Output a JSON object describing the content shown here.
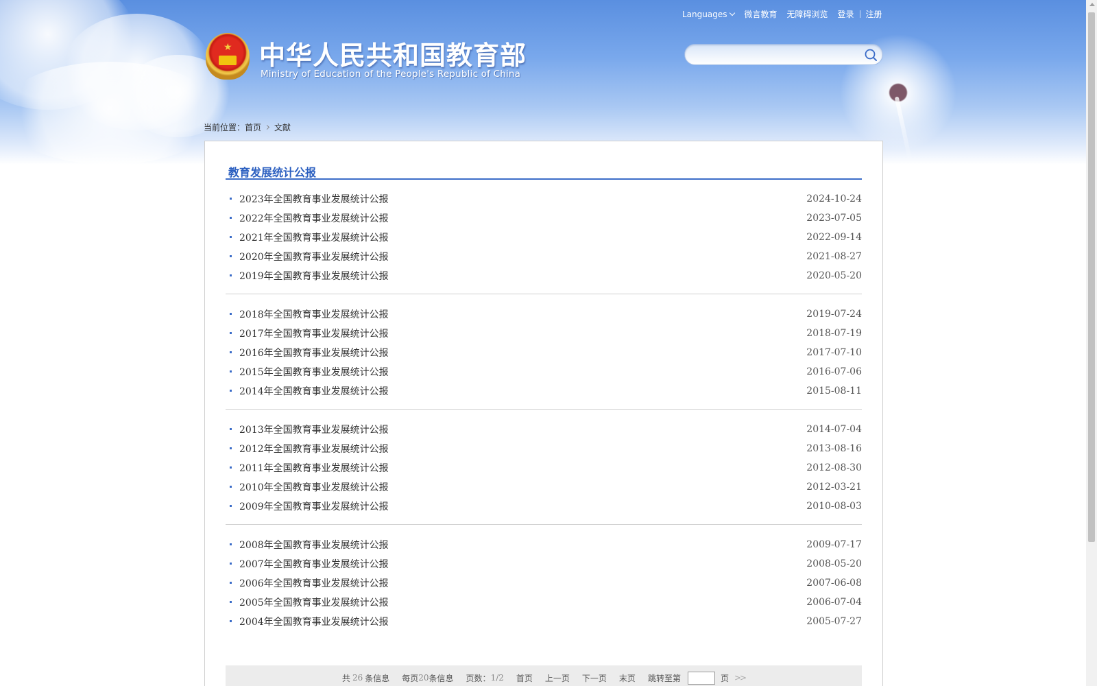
{
  "header": {
    "site_title": "中华人民共和国教育部",
    "site_subtitle": "Ministry of Education of the People's Republic of China",
    "top_links": {
      "languages": "Languages",
      "weiyan": "微言教育",
      "accessible": "无障碍浏览",
      "login": "登录",
      "register": "注册"
    },
    "search": {
      "value": "",
      "placeholder": ""
    }
  },
  "breadcrumb": {
    "prefix": "当前位置：",
    "home": "首页",
    "current": "文献"
  },
  "section": {
    "title": "教育发展统计公报"
  },
  "list": [
    {
      "title": "2023年全国教育事业发展统计公报",
      "date": "2024-10-24"
    },
    {
      "title": "2022年全国教育事业发展统计公报",
      "date": "2023-07-05"
    },
    {
      "title": "2021年全国教育事业发展统计公报",
      "date": "2022-09-14"
    },
    {
      "title": "2020年全国教育事业发展统计公报",
      "date": "2021-08-27"
    },
    {
      "title": "2019年全国教育事业发展统计公报",
      "date": "2020-05-20"
    },
    {
      "title": "2018年全国教育事业发展统计公报",
      "date": "2019-07-24"
    },
    {
      "title": "2017年全国教育事业发展统计公报",
      "date": "2018-07-19"
    },
    {
      "title": "2016年全国教育事业发展统计公报",
      "date": "2017-07-10"
    },
    {
      "title": "2015年全国教育事业发展统计公报",
      "date": "2016-07-06"
    },
    {
      "title": "2014年全国教育事业发展统计公报",
      "date": "2015-08-11"
    },
    {
      "title": "2013年全国教育事业发展统计公报",
      "date": "2014-07-04"
    },
    {
      "title": "2012年全国教育事业发展统计公报",
      "date": "2013-08-16"
    },
    {
      "title": "2011年全国教育事业发展统计公报",
      "date": "2012-08-30"
    },
    {
      "title": "2010年全国教育事业发展统计公报",
      "date": "2012-03-21"
    },
    {
      "title": "2009年全国教育事业发展统计公报",
      "date": "2010-08-03"
    },
    {
      "title": "2008年全国教育事业发展统计公报",
      "date": "2009-07-17"
    },
    {
      "title": "2007年全国教育事业发展统计公报",
      "date": "2008-05-20"
    },
    {
      "title": "2006年全国教育事业发展统计公报",
      "date": "2007-06-08"
    },
    {
      "title": "2005年全国教育事业发展统计公报",
      "date": "2006-07-04"
    },
    {
      "title": "2004年全国教育事业发展统计公报",
      "date": "2005-07-27"
    }
  ],
  "pager": {
    "total_prefix": "共",
    "total_count": "26",
    "total_suffix": "条信息",
    "per_page_prefix": "每页",
    "per_page_count": "20",
    "per_page_suffix": "条信息",
    "pages_label": "页数：",
    "pages_value": "1/2",
    "first": "首页",
    "prev": "上一页",
    "next": "下一页",
    "last": "末页",
    "jump_label": "跳转至第",
    "jump_value": "",
    "page_suffix": "页",
    "go": ">>"
  },
  "icons": {
    "search": "search-icon",
    "languages_dropdown": "chevron-down-icon",
    "breadcrumb_separator": "chevron-right-icon",
    "emblem": "national-emblem-icon"
  },
  "colors": {
    "accent": "#3b6cc8",
    "header_sky": "#5a8fe0",
    "pager_bg": "#ececec"
  }
}
